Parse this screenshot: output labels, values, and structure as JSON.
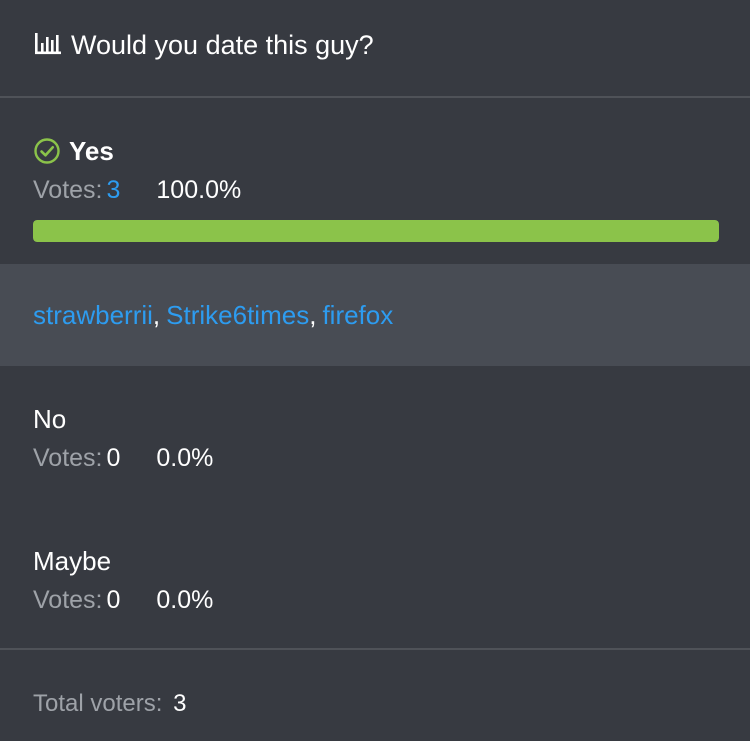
{
  "poll": {
    "title": "Would you date this guy?",
    "header_icon": "bar-chart-icon",
    "accent_color": "#8bc34a",
    "link_color": "#2d9cf0"
  },
  "options": [
    {
      "label": "Yes",
      "selected": true,
      "selected_icon": "check-circle-icon",
      "votes_prefix": "Votes:",
      "votes": "3",
      "percent": "100.0%",
      "progress_fraction": 1.0,
      "voters": [
        "strawberrii",
        "Strike6times",
        "firefox"
      ],
      "voter_separator": ","
    },
    {
      "label": "No",
      "selected": false,
      "votes_prefix": "Votes:",
      "votes": "0",
      "percent": "0.0%"
    },
    {
      "label": "Maybe",
      "selected": false,
      "votes_prefix": "Votes:",
      "votes": "0",
      "percent": "0.0%"
    }
  ],
  "footer": {
    "total_label": "Total voters:",
    "total_count": "3"
  }
}
